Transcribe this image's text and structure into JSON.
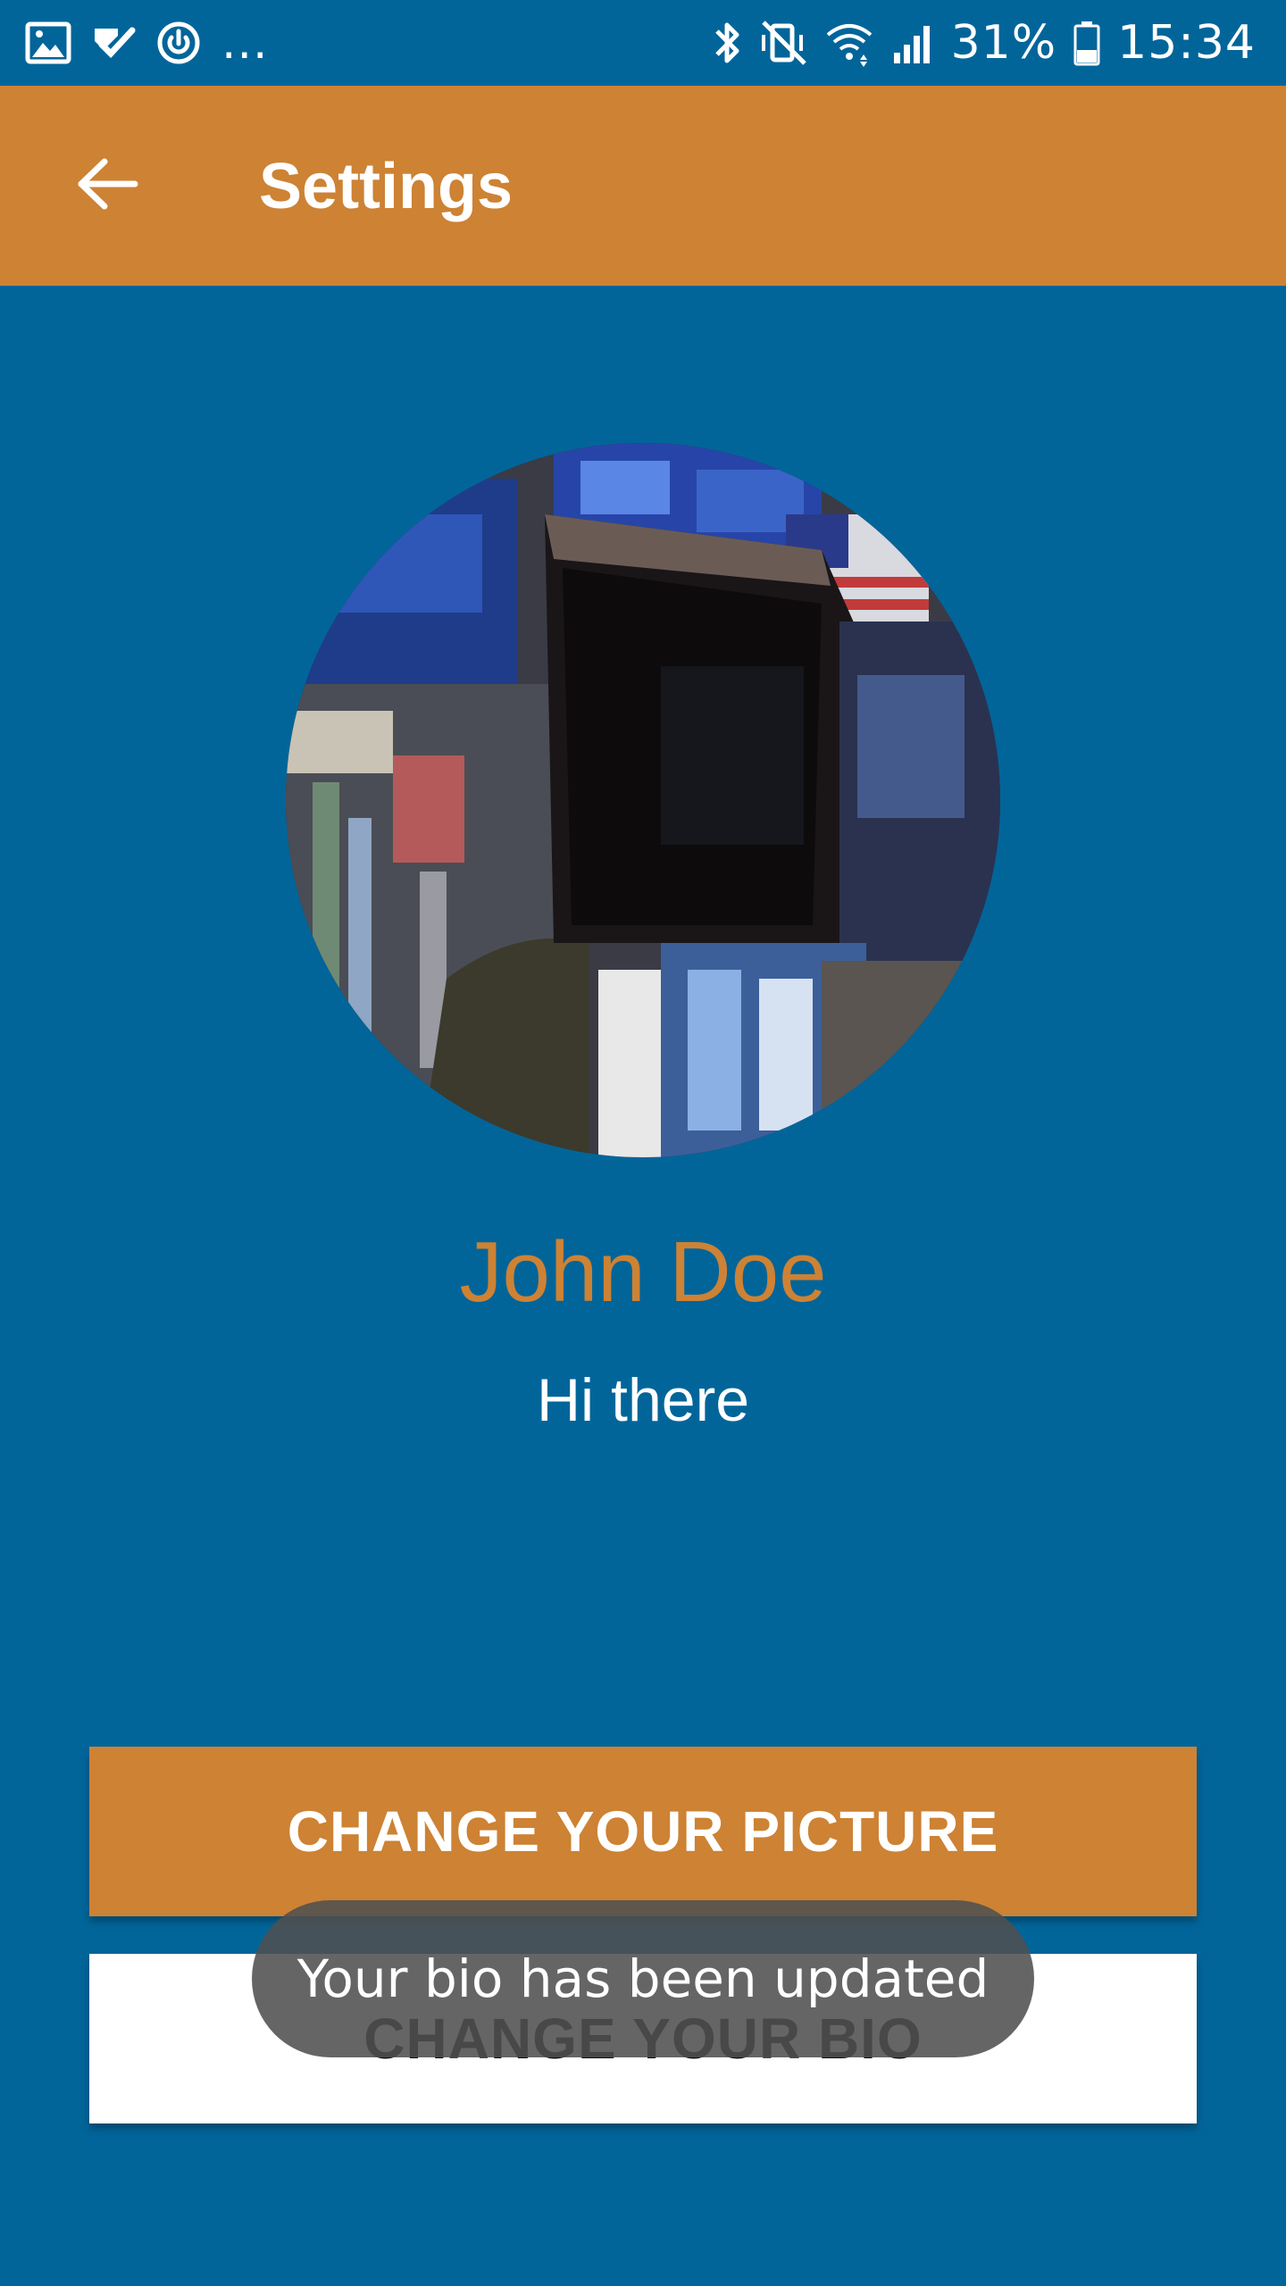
{
  "status_bar": {
    "overflow": "...",
    "battery": "31%",
    "time": "15:34",
    "icons_left": [
      "image-icon",
      "task-check-icon",
      "sync-power-icon"
    ],
    "icons_right": [
      "bluetooth-icon",
      "vibrate-mute-icon",
      "wifi-icon",
      "signal-icon",
      "battery-icon"
    ]
  },
  "app_bar": {
    "title": "Settings",
    "back_icon": "arrow-back-icon"
  },
  "profile": {
    "name": "John Doe",
    "bio": "Hi there"
  },
  "buttons": {
    "change_picture": "CHANGE YOUR PICTURE",
    "change_bio": "CHANGE YOUR BIO"
  },
  "toast": {
    "message": "Your bio has been updated"
  },
  "colors": {
    "background": "#02659a",
    "accent": "#cd8234",
    "button_secondary": "#ffffff",
    "toast_bg": "#505050"
  }
}
